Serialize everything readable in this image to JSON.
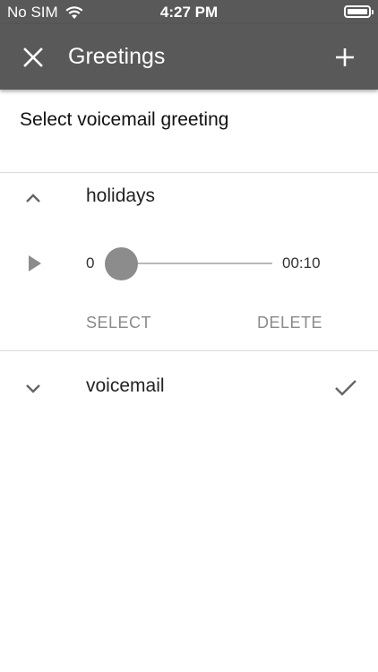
{
  "status_bar": {
    "carrier": "No SIM",
    "time": "4:27 PM"
  },
  "app_bar": {
    "title": "Greetings"
  },
  "section": {
    "heading": "Select voicemail greeting"
  },
  "greetings": [
    {
      "label": "holidays",
      "expanded": true,
      "player": {
        "current_time": "0:00",
        "duration": "00:10",
        "progress": 0
      },
      "actions": {
        "select_label": "SELECT",
        "delete_label": "DELETE"
      }
    },
    {
      "label": "voicemail",
      "expanded": false,
      "selected": true
    }
  ],
  "icons": {
    "status": [
      "wifi-icon",
      "battery-icon"
    ],
    "app_bar": [
      "close-icon",
      "plus-icon"
    ],
    "rows": [
      "chevron-up-icon",
      "chevron-down-icon",
      "play-icon",
      "checkmark-icon"
    ]
  },
  "colors": {
    "app_bar": "#595959",
    "action_text": "#8a8a8a",
    "slider_thumb": "#8c8c8c"
  }
}
